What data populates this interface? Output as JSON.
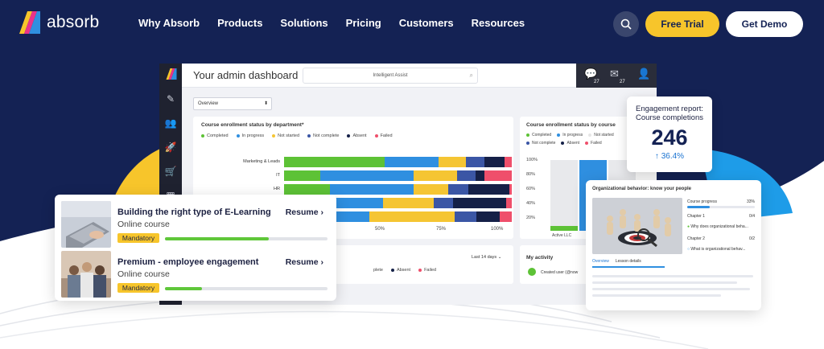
{
  "nav": {
    "logo_text": "absorb",
    "links": [
      "Why Absorb",
      "Products",
      "Solutions",
      "Pricing",
      "Customers",
      "Resources"
    ],
    "free_trial": "Free Trial",
    "get_demo": "Get Demo"
  },
  "dashboard": {
    "title": "Your admin dashboard",
    "assist": "Intelligent Assist",
    "inbox_count": "27",
    "chat_count": "27",
    "select_value": "Overview",
    "dept_card": {
      "title": "Course enrollment status by department*",
      "legend": [
        {
          "label": "Completed",
          "color": "#5dc236"
        },
        {
          "label": "In progress",
          "color": "#2f8fe0"
        },
        {
          "label": "Not started",
          "color": "#f5c533"
        },
        {
          "label": "Not complete",
          "color": "#3b56a5"
        },
        {
          "label": "Absent",
          "color": "#152047"
        },
        {
          "label": "Failed",
          "color": "#ef4f6b"
        }
      ],
      "rows": [
        {
          "label": "Marketing & Leads",
          "values": [
            44,
            24,
            12,
            8,
            9,
            3
          ]
        },
        {
          "label": "IT",
          "values": [
            16,
            41,
            19,
            8,
            4,
            12
          ]
        },
        {
          "label": "HR",
          "values": [
            20,
            37,
            15,
            9,
            18,
            1
          ]
        },
        {
          "label": "",
          "values": [
            0,
            37,
            19,
            7,
            20,
            2
          ]
        },
        {
          "label": "",
          "values": [
            0,
            36,
            36,
            9,
            10,
            5
          ]
        }
      ],
      "axis": [
        "50%",
        "75%",
        "100%"
      ]
    },
    "course_card": {
      "title": "Course enrollment status by course",
      "legend": [
        {
          "label": "Completed",
          "color": "#5dc236"
        },
        {
          "label": "In progress",
          "color": "#2f8fe0"
        },
        {
          "label": "Not started",
          "color": "#e6e6e6"
        },
        {
          "label": "Not complete",
          "color": "#3b56a5"
        },
        {
          "label": "Absent",
          "color": "#152047"
        },
        {
          "label": "Failed",
          "color": "#ef4f6b"
        }
      ],
      "yticks": [
        "100%",
        "80%",
        "60%",
        "40%",
        "20%"
      ],
      "xlabel": "Active LLC"
    },
    "lower_card": {
      "legend": [
        "plete",
        "Absent",
        "Failed"
      ],
      "range": "Last 14 days"
    },
    "activity": {
      "title": "My activity",
      "item": "Created user (@now"
    }
  },
  "engagement": {
    "title": "Engagement report: Course completions",
    "value": "246",
    "change": "↑ 36.4%"
  },
  "courses": [
    {
      "title": "Building the right type of E-Learning",
      "type": "Online course",
      "badge": "Mandatory",
      "resume": "Resume",
      "progress": 0.64
    },
    {
      "title": "Premium - employee engagement",
      "type": "Online course",
      "badge": "Mandatory",
      "resume": "Resume",
      "progress": 0.23
    }
  ],
  "org": {
    "title": "Organizational behavior: know your people",
    "progress_label": "Course progress",
    "progress_value": "33%",
    "chapter1": "Chapter 1",
    "chapter1_count": "0/4",
    "lesson1": "Why does organizational beha...",
    "chapter2": "Chapter 2",
    "chapter2_count": "0/2",
    "lesson2": "What is organizational behav...",
    "tab_overview": "Overview",
    "tab_lesson": "Lesson details"
  }
}
